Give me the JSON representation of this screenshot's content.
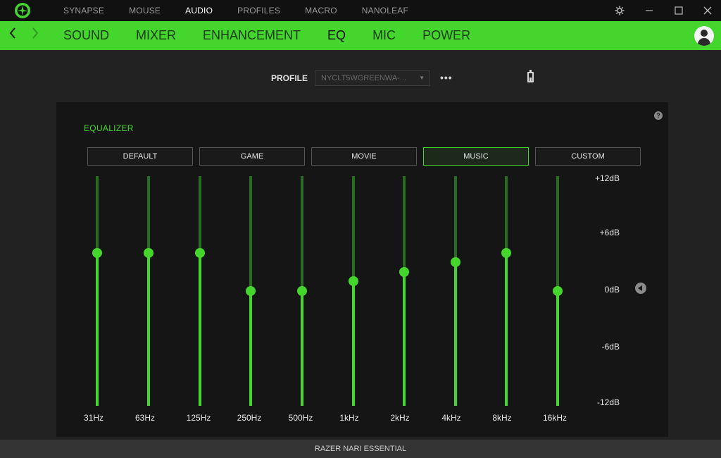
{
  "topnav": {
    "items": [
      "SYNAPSE",
      "MOUSE",
      "AUDIO",
      "PROFILES",
      "MACRO",
      "NANOLEAF"
    ],
    "active_index": 2
  },
  "subnav": {
    "tabs": [
      "SOUND",
      "MIXER",
      "ENHANCEMENT",
      "EQ",
      "MIC",
      "POWER"
    ],
    "active_index": 3
  },
  "profile": {
    "label": "PROFILE",
    "value": "NYCLT5WGREENWA-..."
  },
  "equalizer": {
    "title": "EQUALIZER",
    "help_icon": "?",
    "presets": [
      {
        "label": "DEFAULT",
        "active": false
      },
      {
        "label": "GAME",
        "active": false
      },
      {
        "label": "MOVIE",
        "active": false
      },
      {
        "label": "MUSIC",
        "active": true
      },
      {
        "label": "CUSTOM",
        "active": false
      }
    ],
    "bands": [
      {
        "label": "31Hz",
        "db": 4
      },
      {
        "label": "63Hz",
        "db": 4
      },
      {
        "label": "125Hz",
        "db": 4
      },
      {
        "label": "250Hz",
        "db": 0
      },
      {
        "label": "500Hz",
        "db": 0
      },
      {
        "label": "1kHz",
        "db": 1
      },
      {
        "label": "2kHz",
        "db": 2
      },
      {
        "label": "4kHz",
        "db": 3
      },
      {
        "label": "8kHz",
        "db": 4
      },
      {
        "label": "16kHz",
        "db": 0
      }
    ],
    "db_range": [
      -12,
      12
    ],
    "db_labels": [
      "+12dB",
      "+6dB",
      "0dB",
      "-6dB",
      "-12dB"
    ]
  },
  "footer": {
    "device_name": "RAZER NARI ESSENTIAL"
  },
  "colors": {
    "accent": "#44d62c",
    "background": "#222222",
    "panel": "#151515",
    "titlebar": "#111111"
  }
}
